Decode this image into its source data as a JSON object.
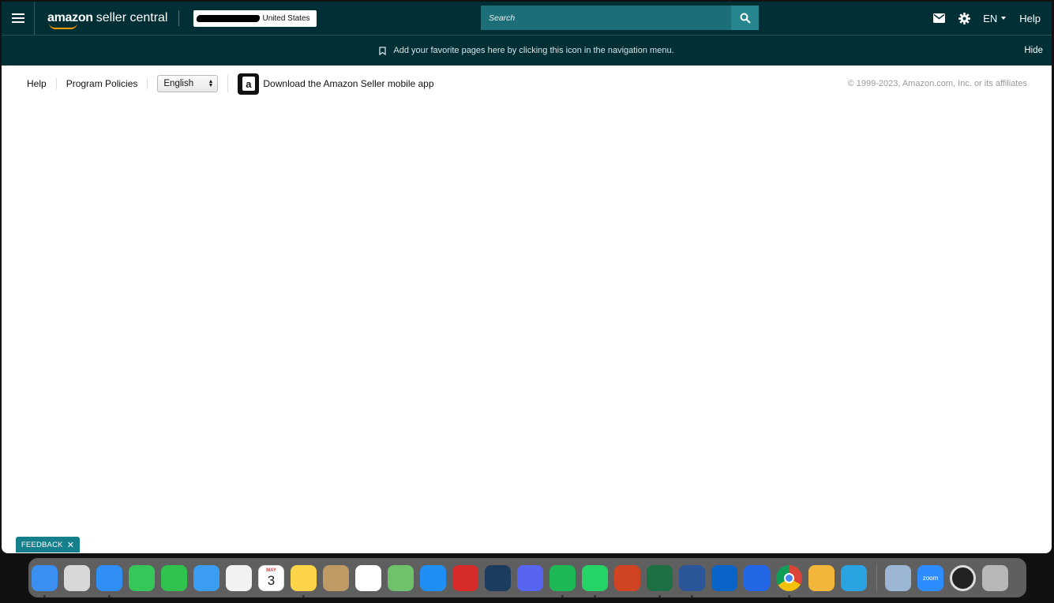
{
  "nav": {
    "logo_amazon": "amazon",
    "logo_rest": "seller central",
    "marketplace_country": "United States",
    "search_placeholder": "Search",
    "language": "EN",
    "help": "Help"
  },
  "favorites_bar": {
    "message": "Add your favorite pages here by clicking this icon in the navigation menu.",
    "hide_label": "Hide"
  },
  "footer": {
    "links": [
      "Help",
      "Program Policies"
    ],
    "language_select": "English",
    "app_download": "Download the Amazon Seller mobile app",
    "app_icon_letter": "a",
    "copyright": "© 1999-2023, Amazon.com, Inc. or its affiliates"
  },
  "feedback": {
    "label": "FEEDBACK",
    "close": "✕"
  },
  "dock": {
    "calendar_month": "MAY",
    "calendar_day": "3",
    "zoom_label": "zoom",
    "apps": [
      {
        "name": "finder",
        "color": "#3b8ff0",
        "dot": true
      },
      {
        "name": "launchpad",
        "color": "#d8d8d8",
        "dot": false
      },
      {
        "name": "safari",
        "color": "#2f8ff5",
        "dot": true
      },
      {
        "name": "messages",
        "color": "#35c759",
        "dot": false
      },
      {
        "name": "facetime",
        "color": "#2fc24d",
        "dot": false
      },
      {
        "name": "mail",
        "color": "#3a9df2",
        "dot": false
      },
      {
        "name": "photos",
        "color": "#f2f2f2",
        "dot": false
      },
      {
        "name": "calendar",
        "color": "#ffffff",
        "dot": false
      },
      {
        "name": "notes",
        "color": "#fbd448",
        "dot": true
      },
      {
        "name": "contacts",
        "color": "#c09a64",
        "dot": false
      },
      {
        "name": "reminders",
        "color": "#ffffff",
        "dot": false
      },
      {
        "name": "maps",
        "color": "#6fc26b",
        "dot": false
      },
      {
        "name": "app-store",
        "color": "#1f8ef5",
        "dot": false
      },
      {
        "name": "photo-booth",
        "color": "#d72a2a",
        "dot": false
      },
      {
        "name": "steam",
        "color": "#1b3b5f",
        "dot": false
      },
      {
        "name": "discord",
        "color": "#5865f2",
        "dot": false
      },
      {
        "name": "spotify",
        "color": "#1db954",
        "dot": true
      },
      {
        "name": "whatsapp",
        "color": "#25d366",
        "dot": true
      },
      {
        "name": "powerpoint",
        "color": "#d04423",
        "dot": false
      },
      {
        "name": "excel",
        "color": "#1d7044",
        "dot": true
      },
      {
        "name": "word",
        "color": "#2b579a",
        "dot": true
      },
      {
        "name": "outlook",
        "color": "#0a64c8",
        "dot": false
      },
      {
        "name": "pencil-app",
        "color": "#2467e6",
        "dot": false
      },
      {
        "name": "chrome",
        "color": "#ffffff",
        "dot": true
      },
      {
        "name": "cyberduck",
        "color": "#f2b63a",
        "dot": false
      },
      {
        "name": "telegram",
        "color": "#2aa3e3",
        "dot": false
      }
    ],
    "right_apps": [
      {
        "name": "preview",
        "color": "#9bb7d4"
      },
      {
        "name": "zoom",
        "color": "#2d8cff"
      },
      {
        "name": "clock",
        "color": "#222222"
      },
      {
        "name": "trash",
        "color": "#b7b7b7"
      }
    ]
  }
}
